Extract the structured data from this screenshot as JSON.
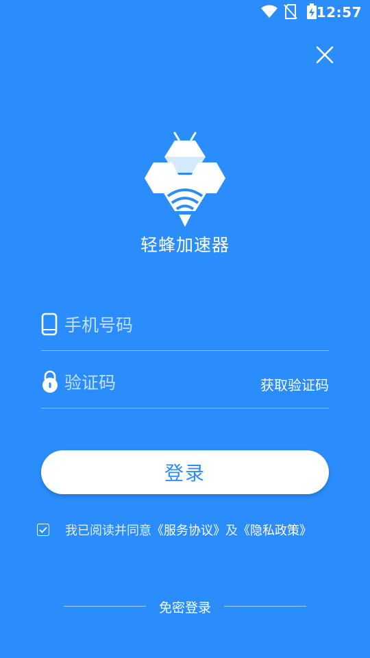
{
  "status_bar": {
    "time": "12:57",
    "icons": [
      "wifi-icon",
      "no-sim-icon",
      "battery-charging-icon"
    ]
  },
  "header": {
    "close_icon": "close-icon"
  },
  "app": {
    "name": "轻蜂加速器",
    "logo_icon": "bee-logo-icon"
  },
  "form": {
    "phone": {
      "placeholder": "手机号码",
      "value": "",
      "icon": "phone-icon"
    },
    "code": {
      "placeholder": "验证码",
      "value": "",
      "icon": "lock-icon",
      "get_code_label": "获取验证码"
    },
    "login_label": "登录"
  },
  "agreement": {
    "checked": true,
    "prefix": "我已阅读并同意",
    "service_link": "《服务协议》",
    "conjunction": "及",
    "privacy_link": "《隐私政策》"
  },
  "footer": {
    "alt_login_label": "免密登录"
  },
  "colors": {
    "background": "#2a8dfb",
    "button_bg": "#ffffff",
    "button_text": "#2a8dfb"
  }
}
